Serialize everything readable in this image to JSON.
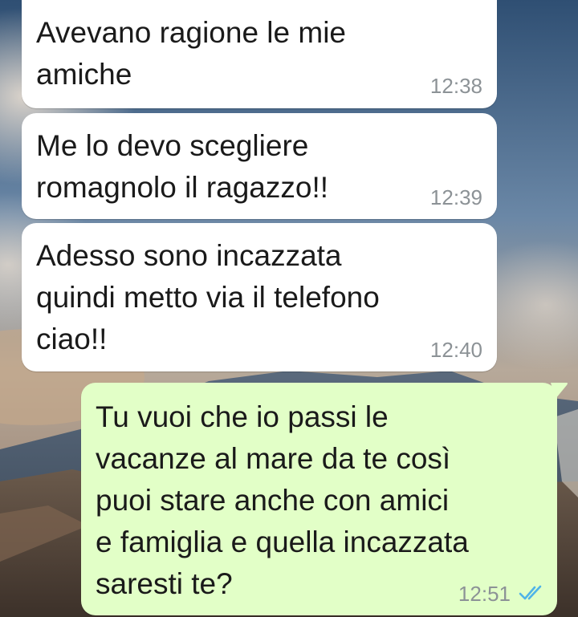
{
  "messages": [
    {
      "direction": "incoming",
      "text": "Avevano ragione le mie\namiche",
      "time": "12:38"
    },
    {
      "direction": "incoming",
      "text": "Me lo devo scegliere\nromagnolo il ragazzo!!",
      "time": "12:39"
    },
    {
      "direction": "incoming",
      "text": "Adesso sono incazzata\nquindi metto via il telefono\nciao!!",
      "time": "12:40"
    },
    {
      "direction": "outgoing",
      "text": "Tu vuoi che io passi le\nvacanze al mare da te così\npuoi stare anche con amici\ne famiglia e quella incazzata\nsaresti te?",
      "time": "12:51",
      "status_icon": "double-check-read-icon"
    }
  ],
  "colors": {
    "incoming_bubble": "#ffffff",
    "outgoing_bubble": "#e2ffc7",
    "timestamp": "#8c9296",
    "read_ticks": "#4fb3e8"
  }
}
